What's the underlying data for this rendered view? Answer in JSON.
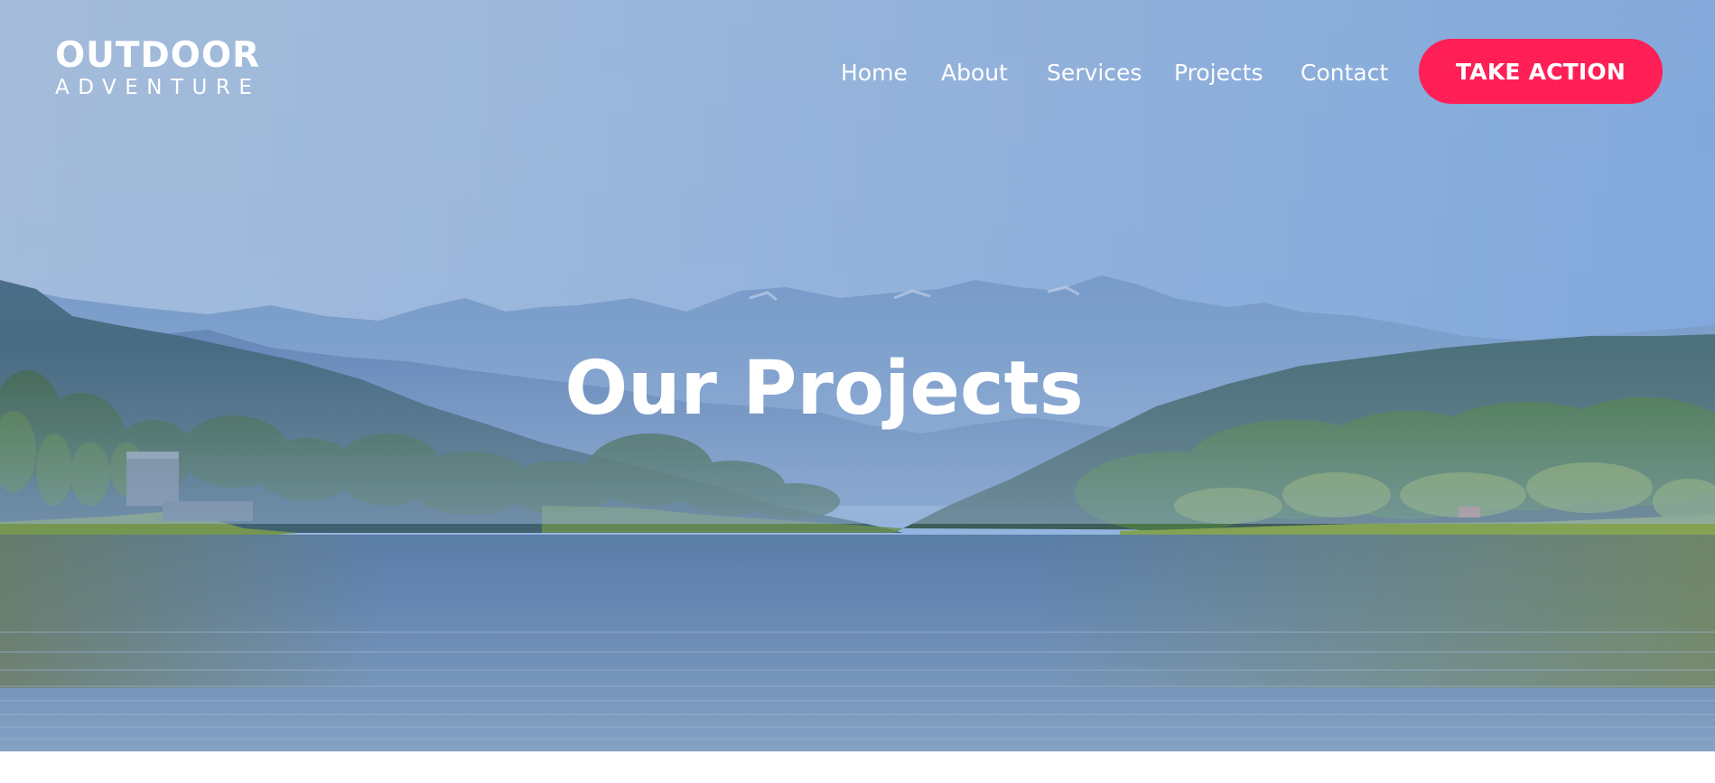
{
  "logo": {
    "line1": "OUTDOOR",
    "line2": "ADVENTURE"
  },
  "nav": {
    "items": [
      {
        "label": "Home"
      },
      {
        "label": "About"
      },
      {
        "label": "Services"
      },
      {
        "label": "Projects"
      },
      {
        "label": "Contact"
      }
    ],
    "cta_label": "TAKE ACTION"
  },
  "hero": {
    "title": "Our Projects"
  },
  "colors": {
    "accent": "#ff1f57",
    "text": "#ffffff",
    "sky": "#9fbde2",
    "water": "#5a7ea8"
  }
}
